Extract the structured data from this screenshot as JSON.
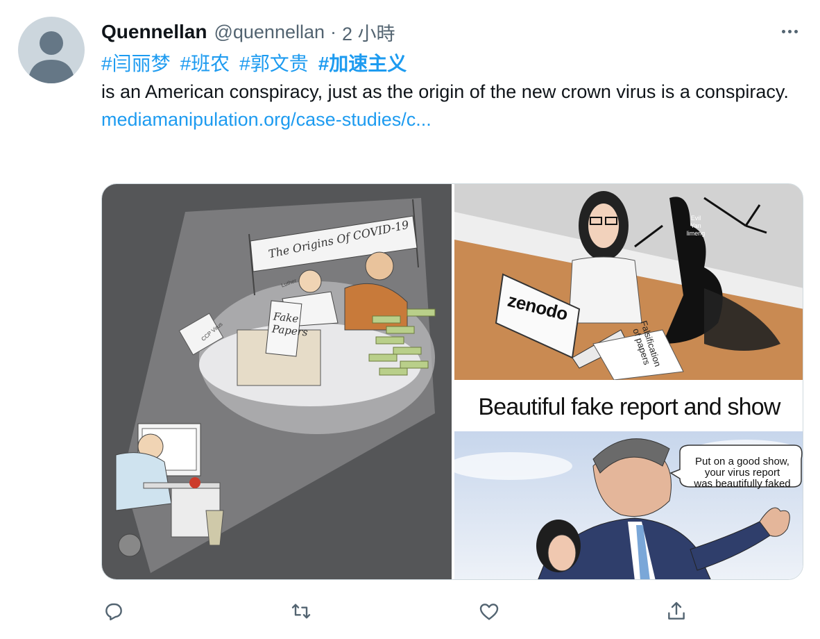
{
  "tweet": {
    "author": {
      "display_name": "Quennellan",
      "handle": "@quennellan",
      "separator": "·",
      "time": "2 小時",
      "avatar_icon": "default-avatar-icon"
    },
    "more_icon": "more-dots-icon",
    "hashtags": [
      {
        "text": "#闫丽梦",
        "bold": false
      },
      {
        "text": "#班农",
        "bold": false
      },
      {
        "text": "#郭文贵",
        "bold": false
      },
      {
        "text": "#加速主义",
        "bold": true
      }
    ],
    "body": " is an American conspiracy, just as the origin of the new crown virus is a conspiracy.",
    "link_text": "mediamanipulation.org/case-studies/c...",
    "media": {
      "panel1": {
        "sign": "The Origins Of COVID-19",
        "paper": "Fake\nPapers",
        "ccp": "CCP Virus",
        "luther": "Luther"
      },
      "panel2": {
        "laptop": "zenodo",
        "shadow": "Evil\nYan\nlimeng",
        "paper": "Falsification\nof papers"
      },
      "panel3": {
        "title": "Beautiful  fake report and show",
        "bubble": "Put on a good show,\nyour virus report\nwas beautifully faked"
      }
    },
    "actions": [
      {
        "name": "reply-icon"
      },
      {
        "name": "retweet-icon"
      },
      {
        "name": "like-icon"
      },
      {
        "name": "share-icon"
      }
    ],
    "colors": {
      "link": "#1d9bf0",
      "text": "#0f1419",
      "secondary": "#536471",
      "border": "#cfd9de"
    }
  }
}
